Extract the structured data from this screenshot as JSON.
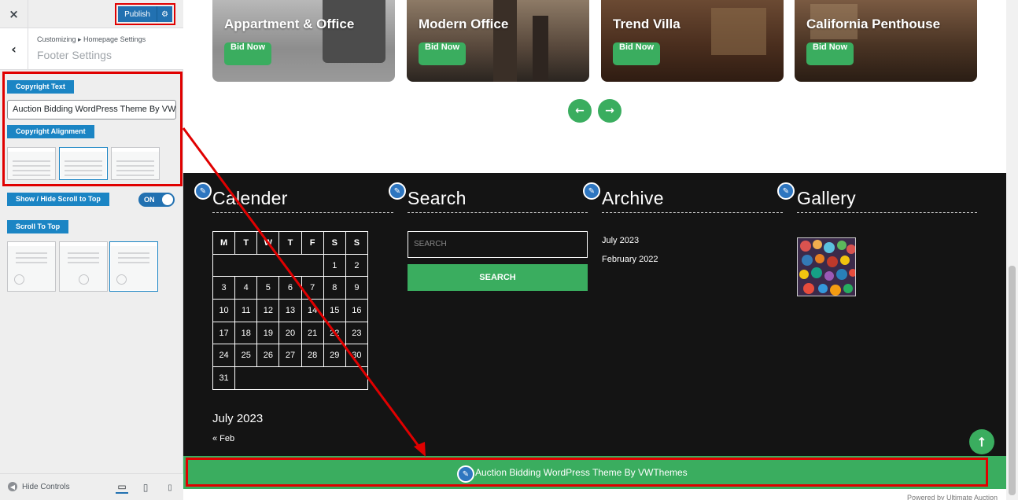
{
  "sidebar": {
    "close_icon": "×",
    "publish_label": "Publish",
    "breadcrumb": "Customizing ▸ Homepage Settings",
    "section_title": "Footer Settings",
    "copyright_text_label": "Copyright Text",
    "copyright_text_value": "Auction Bidding WordPress Theme By VWThemes",
    "copyright_alignment_label": "Copyright Alignment",
    "alignment_selected": "center",
    "scroll_toggle_label": "Show / Hide Scroll to Top",
    "scroll_toggle_state": "ON",
    "scroll_to_top_label": "Scroll To Top",
    "scroll_to_top_selected": "right",
    "hide_controls_label": "Hide Controls",
    "device_selected": "desktop"
  },
  "preview": {
    "cards": [
      {
        "title": "Appartment & Office",
        "button": "Bid Now"
      },
      {
        "title": "Modern Office",
        "button": "Bid Now"
      },
      {
        "title": "Trend Villa",
        "button": "Bid Now"
      },
      {
        "title": "California Penthouse",
        "button": "Bid Now"
      }
    ],
    "nav_prev": "←",
    "nav_next": "→",
    "widgets": {
      "calendar": {
        "title": "Calender",
        "days": [
          "M",
          "T",
          "W",
          "T",
          "F",
          "S",
          "S"
        ],
        "rows": [
          [
            "",
            "",
            "",
            "",
            "",
            "1",
            "2"
          ],
          [
            "3",
            "4",
            "5",
            "6",
            "7",
            "8",
            "9"
          ],
          [
            "10",
            "11",
            "12",
            "13",
            "14",
            "15",
            "16"
          ],
          [
            "17",
            "18",
            "19",
            "20",
            "21",
            "22",
            "23"
          ],
          [
            "24",
            "25",
            "26",
            "27",
            "28",
            "29",
            "30"
          ],
          [
            "31",
            "",
            "",
            "",
            "",
            "",
            ""
          ]
        ],
        "caption": "July 2023",
        "prev_link": "« Feb"
      },
      "search": {
        "title": "Search",
        "placeholder": "SEARCH",
        "button": "SEARCH"
      },
      "archive": {
        "title": "Archive",
        "items": [
          "July 2023",
          "February 2022"
        ]
      },
      "gallery": {
        "title": "Gallery"
      }
    },
    "copyright": "Auction Bidding WordPress Theme By VWThemes",
    "powered_by": "Powered by Ultimate Auction",
    "to_top_icon": "↑"
  },
  "colors": {
    "accent_green": "#3aad5f",
    "footer_bg": "#141414",
    "wp_blue": "#2271b1",
    "label_blue": "#1b85c4",
    "highlight_red": "#e00000"
  }
}
